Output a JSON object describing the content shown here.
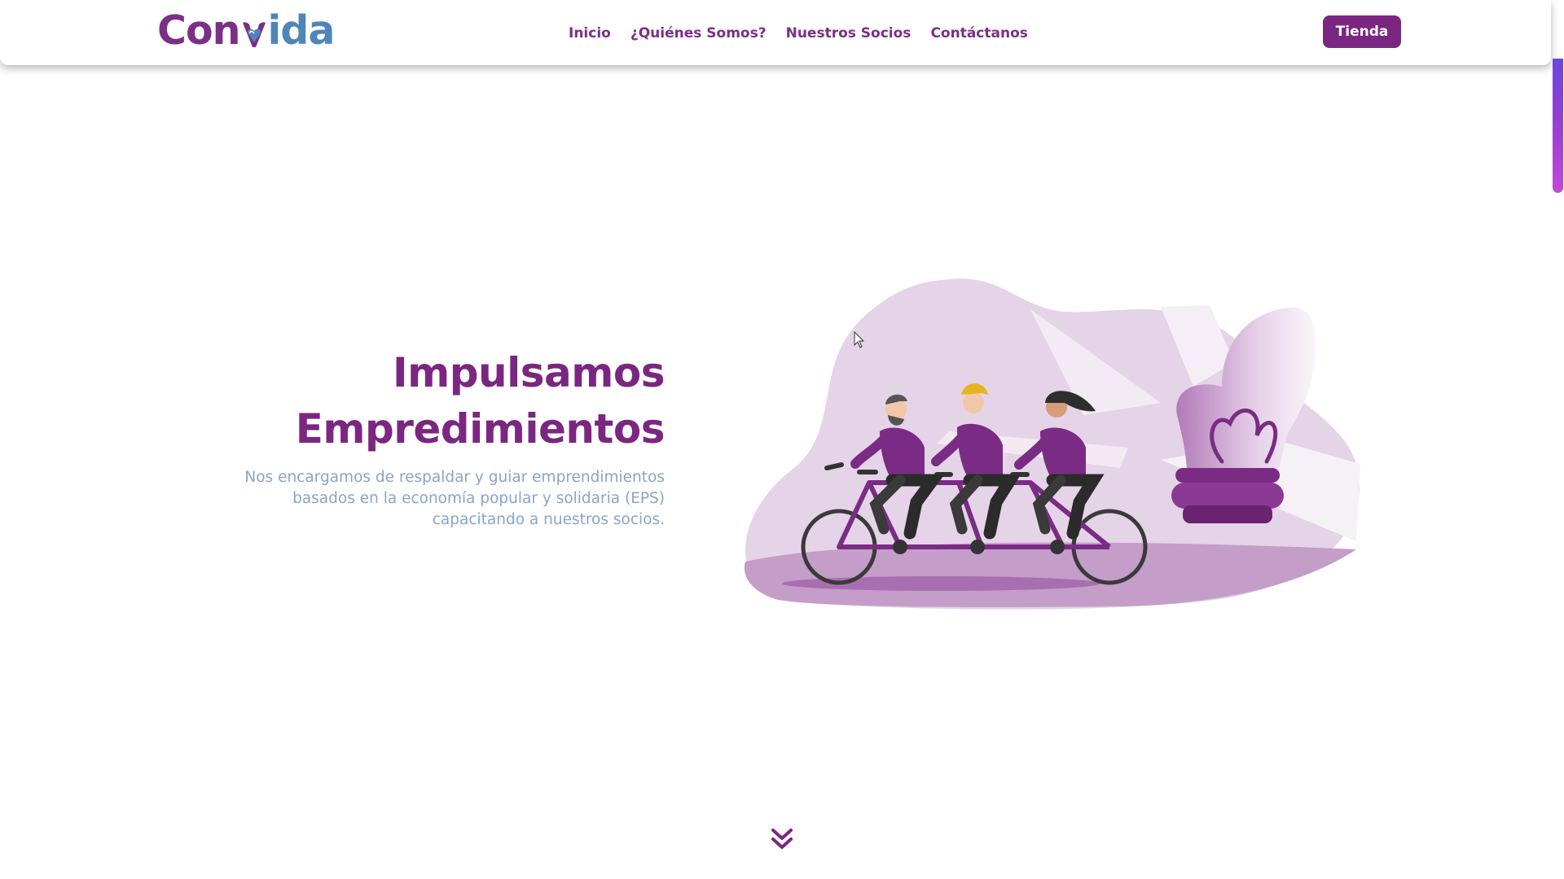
{
  "header": {
    "logo": {
      "part1": "Con",
      "part2": "ida",
      "mark_icon": "heart-v-icon"
    },
    "nav": [
      {
        "label": "Inicio"
      },
      {
        "label": "¿Quiénes Somos?"
      },
      {
        "label": "Nuestros Socios"
      },
      {
        "label": "Contáctanos"
      }
    ],
    "shop_button": "Tienda"
  },
  "hero": {
    "title_line1": "Impulsamos",
    "title_line2": "Empredimientos",
    "subtitle_line1": "Nos encargamos de respaldar y guiar emprendimientos",
    "subtitle_line2": "basados en la economía popular y solidaria (EPS)",
    "subtitle_line3": "capacitando a nuestros socios.",
    "illustration": "tandem-bike-lightbulb-illustration"
  },
  "scroll_down_icon": "double-chevron-down-icon",
  "colors": {
    "brand_purple": "#7b2680",
    "brand_blue": "#4f86b9",
    "subtitle_blue": "#8aa4c8",
    "blob_lilac": "#e5d3e8"
  }
}
